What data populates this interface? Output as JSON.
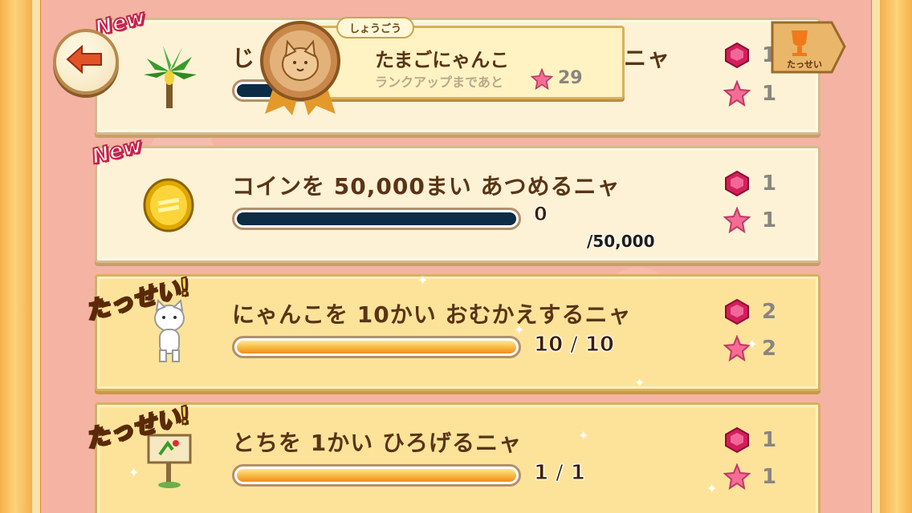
{
  "header": {
    "title_tag": "しょうごう",
    "title_name": "たまごにゃんこ",
    "rank_up_label": "ランクアップまであと",
    "rank_up_stars": "29",
    "trophy_label": "たっせい",
    "partial_first_title_start": "じ",
    "partial_first_title_end": "ニャ"
  },
  "missions": [
    {
      "badge": "New",
      "title": "じ…ニャ",
      "icon": "banana-tree-icon",
      "progress_fraction": 0,
      "rewards": {
        "gems": "1",
        "stars": "1"
      }
    },
    {
      "badge": "New",
      "title": "コインを 50,000まい あつめるニャ",
      "icon": "coin-icon",
      "progress_value": "0",
      "progress_total": "/50,000",
      "progress_fraction": 0,
      "rewards": {
        "gems": "1",
        "stars": "1"
      }
    },
    {
      "badge": "たっせい!",
      "title": "にゃんこを 10かい おむかえするニャ",
      "icon": "white-cat-icon",
      "progress_text": "10 / 10",
      "progress_fraction": 1,
      "rewards": {
        "gems": "2",
        "stars": "2"
      }
    },
    {
      "badge": "たっせい!",
      "title": "とちを 1かい ひろげるニャ",
      "icon": "signboard-icon",
      "progress_text": "1 / 1",
      "progress_fraction": 1,
      "rewards": {
        "gems": "1",
        "stars": "1"
      }
    }
  ],
  "colors": {
    "accent_pink": "#c4234a",
    "done_bar": "#f9b13a",
    "empty_bar": "#0d2c45",
    "title_brown": "#5a3416"
  }
}
